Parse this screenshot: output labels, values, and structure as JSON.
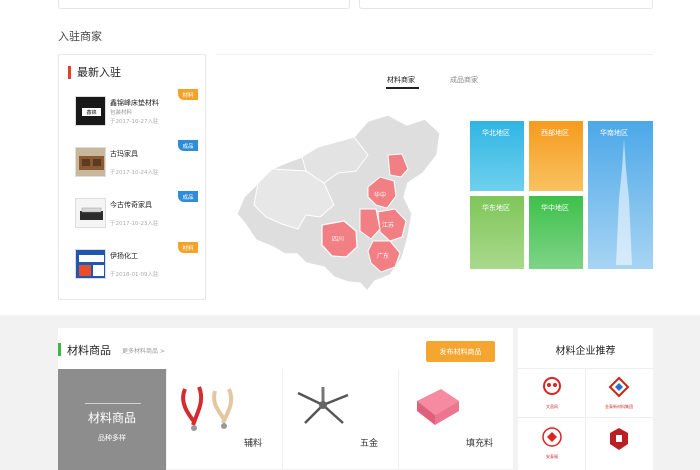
{
  "section": {
    "title": "入驻商家"
  },
  "sidebar": {
    "title": "最新入驻",
    "items": [
      {
        "name": "鑫锦峰床垫材料",
        "sub": "包装材料",
        "date": "于2017-10-27入驻",
        "tag": "材料",
        "tag_color": "orange"
      },
      {
        "name": "古玛家具",
        "sub": "",
        "date": "于2017-10-24入驻",
        "tag": "成品",
        "tag_color": "blue"
      },
      {
        "name": "今古传奇家具",
        "sub": "",
        "date": "于2017-10-23入驻",
        "tag": "成品",
        "tag_color": "blue"
      },
      {
        "name": "伊扬化工",
        "sub": "",
        "date": "于2018-01-09入驻",
        "tag": "材料",
        "tag_color": "orange"
      }
    ]
  },
  "map": {
    "tabs": [
      "材料商家",
      "成品商家"
    ],
    "active_tab": "材料商家",
    "map_labels": [
      "华中",
      "四川",
      "江苏",
      "广东"
    ],
    "regions": [
      {
        "label": "华北地区",
        "color": "#2fb5e3"
      },
      {
        "label": "西部地区",
        "color": "#f69b1e"
      },
      {
        "label": "华南地区",
        "color": "#4ba8e8"
      },
      {
        "label": "华东地区",
        "color": "#7fc65a"
      },
      {
        "label": "华中地区",
        "color": "#3ec04b"
      }
    ]
  },
  "goods": {
    "title": "材料商品",
    "more": "更多材料商品 >",
    "publish_button": "发布材料商品",
    "feature_title": "材料商品",
    "feature_sub": "品种多样",
    "items": [
      "辅料",
      "五金",
      "填充料"
    ]
  },
  "recommend": {
    "title": "材料企业推荐",
    "logos": [
      {
        "name": "logo-1",
        "caption": "文昌网"
      },
      {
        "name": "logo-2",
        "caption": "金泰新材料集团"
      },
      {
        "name": "logo-3",
        "caption": "安泰福"
      },
      {
        "name": "logo-4",
        "caption": "企业标志"
      }
    ]
  }
}
